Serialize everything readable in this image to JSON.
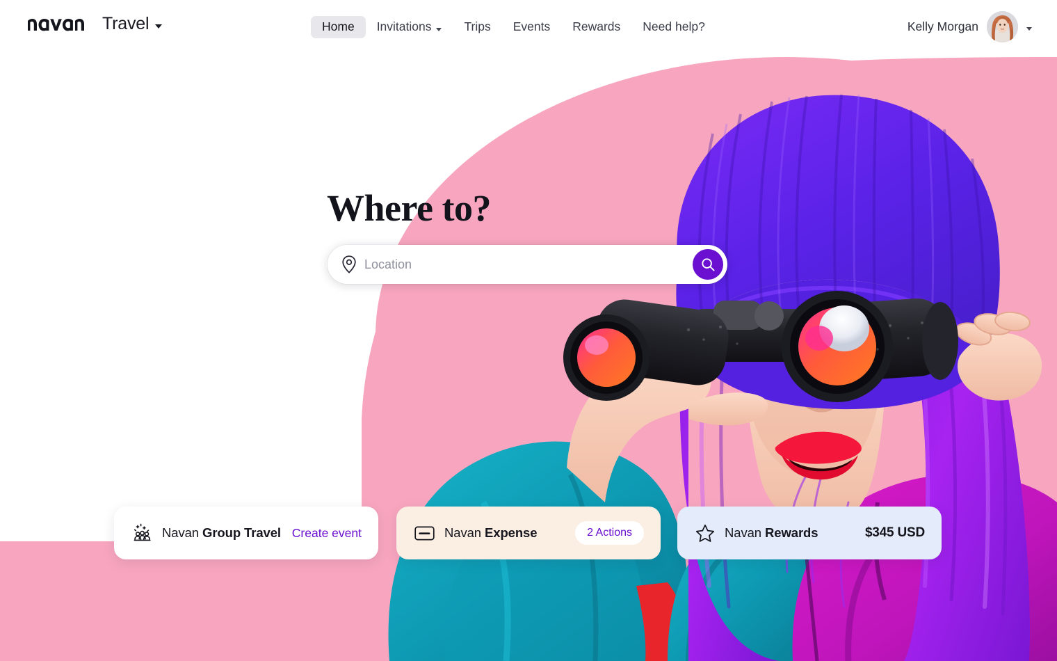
{
  "brand": {
    "logo_text": "navan",
    "product": "Travel",
    "dropdown_icon": "chevron-down-icon",
    "accent_purple": "#6B0FD0"
  },
  "nav": {
    "items": [
      {
        "label": "Home",
        "active": true,
        "has_caret": false
      },
      {
        "label": "Invitations",
        "active": false,
        "has_caret": true
      },
      {
        "label": "Trips",
        "active": false,
        "has_caret": false
      },
      {
        "label": "Events",
        "active": false,
        "has_caret": false
      },
      {
        "label": "Rewards",
        "active": false,
        "has_caret": false
      },
      {
        "label": "Need help?",
        "active": false,
        "has_caret": false
      }
    ]
  },
  "user": {
    "name": "Kelly Morgan",
    "avatar_icon": "user-avatar-photo",
    "dropdown_icon": "chevron-down-icon"
  },
  "hero": {
    "headline": "Where to?",
    "background_pink": "#F8A6BF",
    "image_alt": "woman-with-binoculars-purple-hair"
  },
  "search": {
    "pin_icon": "location-pin-icon",
    "placeholder": "Location",
    "value": "",
    "submit_icon": "search-icon",
    "submit_color": "#6B0FD0"
  },
  "cards": [
    {
      "icon": "group-travel-icon",
      "brand": "Navan ",
      "name": "Group Travel",
      "action_type": "link",
      "action_label": "Create event",
      "bg": "#FFFFFF"
    },
    {
      "icon": "credit-card-icon",
      "brand": "Navan ",
      "name": "Expense",
      "action_type": "badge",
      "action_label": "2 Actions",
      "bg": "#FBEEE3"
    },
    {
      "icon": "star-icon",
      "brand": "Navan ",
      "name": "Rewards",
      "action_type": "amount",
      "action_label": "$345 USD",
      "bg": "#E4EBFA"
    }
  ]
}
